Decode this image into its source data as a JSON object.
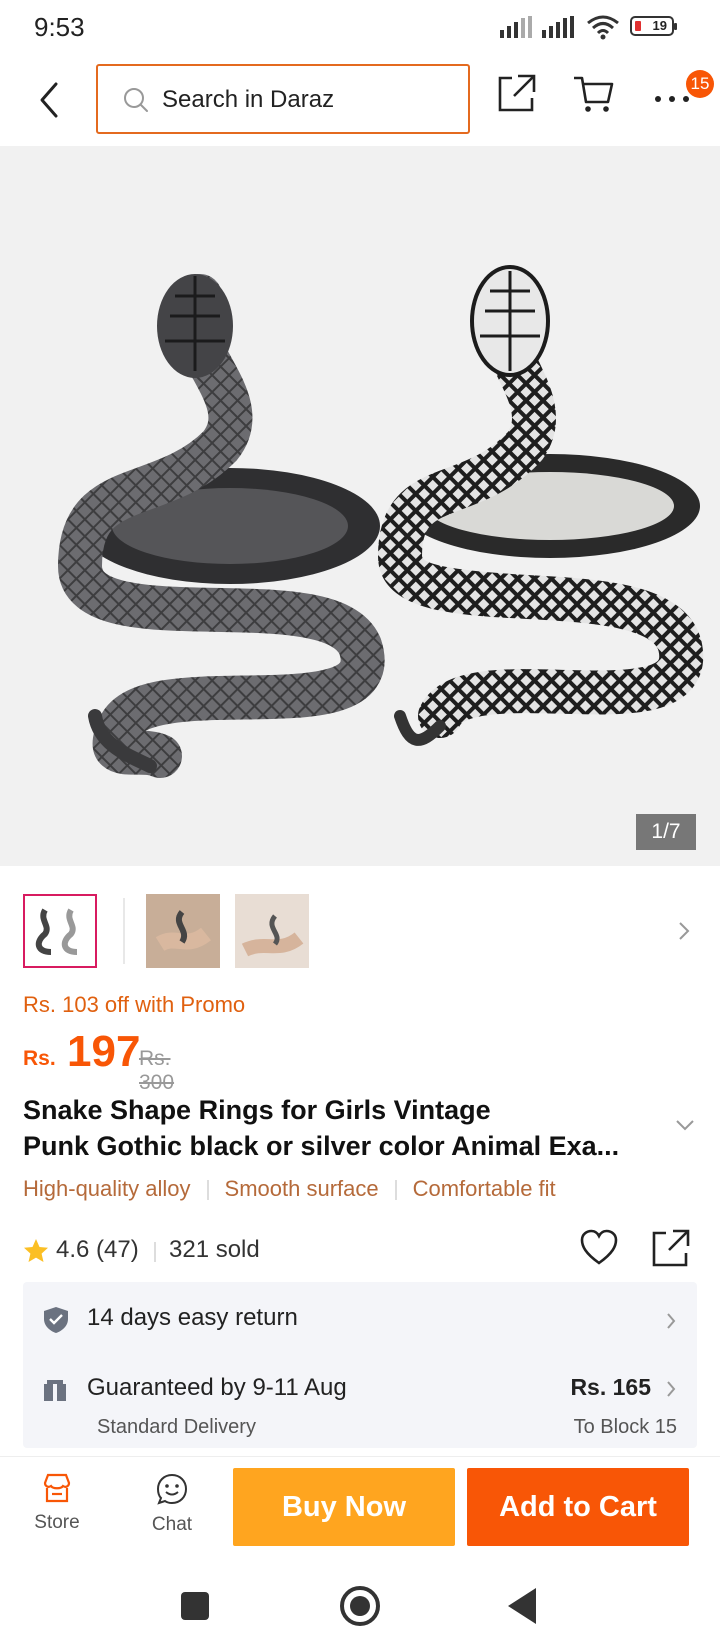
{
  "status_bar": {
    "time": "9:53",
    "battery": "19"
  },
  "header": {
    "search_placeholder": "Search in Daraz",
    "cart_badge": "15"
  },
  "gallery": {
    "counter": "1/7"
  },
  "product": {
    "promo": "Rs. 103 off with Promo",
    "currency": "Rs.",
    "price": "197",
    "original_price": "Rs. 300",
    "title_line1": "Snake Shape Rings for Girls Vintage",
    "title_line2": "Punk Gothic black or silver color Animal Exa...",
    "tags": [
      "High-quality alloy",
      "Smooth surface",
      "Comfortable fit"
    ],
    "rating": "4.6 (47)",
    "sold": "321 sold"
  },
  "info": {
    "returns": "14 days easy return",
    "delivery": "Guaranteed by 9-11 Aug",
    "delivery_type": "Standard Delivery",
    "delivery_price": "Rs. 165",
    "delivery_location": "To Block 15"
  },
  "bottom_bar": {
    "store": "Store",
    "chat": "Chat",
    "buy_now": "Buy Now",
    "add_to_cart": "Add to Cart"
  },
  "colors": {
    "accent": "#f85606",
    "buy_now": "#ffa51f",
    "search_border": "#e46a1f"
  }
}
